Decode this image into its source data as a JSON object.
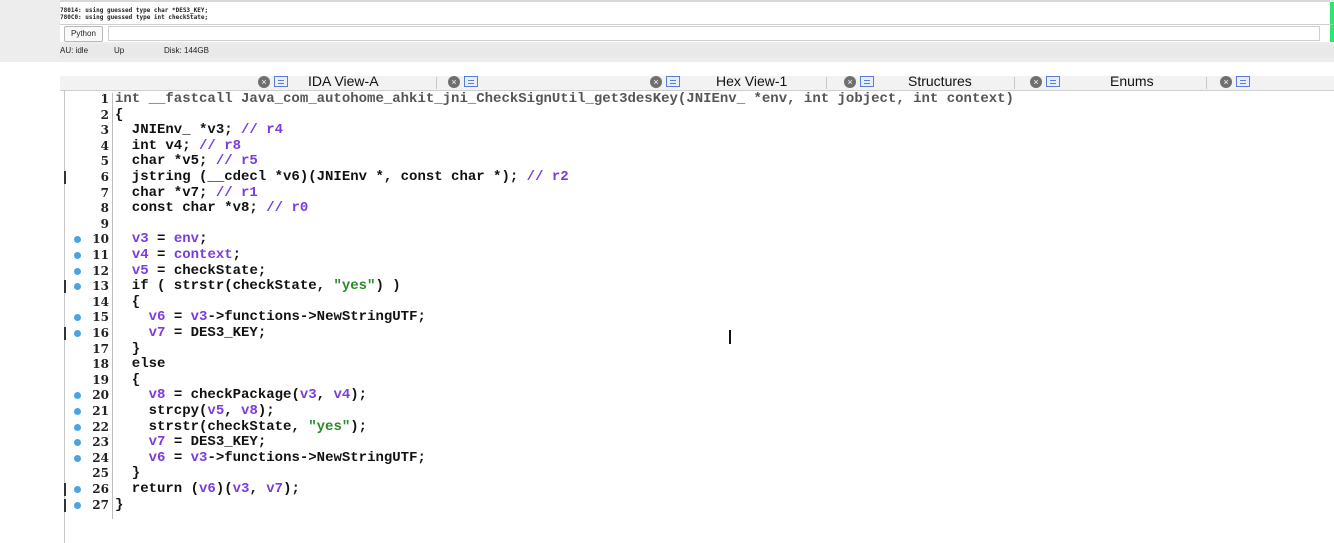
{
  "output": {
    "lines": [
      "78014: using guessed type char *DES3_KEY;",
      "780C0: using guessed type int checkState;"
    ],
    "interpreter_button": "Python"
  },
  "status": {
    "state": "AU: idle",
    "direction": "Up",
    "disk": "Disk: 144GB"
  },
  "tabs": [
    {
      "label": "IDA View-A"
    },
    {
      "label": ""
    },
    {
      "label": "Hex View-1"
    },
    {
      "label": "Structures"
    },
    {
      "label": "Enums"
    }
  ],
  "editor": {
    "lines": [
      {
        "no": "1",
        "bp": false,
        "mark": false,
        "code": [
          [
            "int __fastcall Java_com_autohome_ahkit_jni_CheckSignUtil_get3desKey(JNIEnv_ *env, int jobject, int context)",
            "decl"
          ]
        ]
      },
      {
        "no": "2",
        "bp": false,
        "mark": false,
        "code": [
          [
            "{",
            ""
          ]
        ]
      },
      {
        "no": "3",
        "bp": false,
        "mark": false,
        "code": [
          [
            "  JNIEnv_ *v3; ",
            ""
          ],
          [
            "// r4",
            "var"
          ]
        ]
      },
      {
        "no": "4",
        "bp": false,
        "mark": false,
        "code": [
          [
            "  int v4; ",
            ""
          ],
          [
            "// r8",
            "var"
          ]
        ]
      },
      {
        "no": "5",
        "bp": false,
        "mark": false,
        "code": [
          [
            "  char *v5; ",
            ""
          ],
          [
            "// r5",
            "var"
          ]
        ]
      },
      {
        "no": "6",
        "bp": false,
        "mark": true,
        "code": [
          [
            "  jstring (__cdecl *v6)(JNIEnv *, const char *); ",
            ""
          ],
          [
            "// r2",
            "var"
          ]
        ]
      },
      {
        "no": "7",
        "bp": false,
        "mark": false,
        "code": [
          [
            "  char *v7; ",
            ""
          ],
          [
            "// r1",
            "var"
          ]
        ]
      },
      {
        "no": "8",
        "bp": false,
        "mark": false,
        "code": [
          [
            "  const char *v8; ",
            ""
          ],
          [
            "// r0",
            "var"
          ]
        ]
      },
      {
        "no": "9",
        "bp": false,
        "mark": false,
        "code": [
          [
            "",
            ""
          ]
        ]
      },
      {
        "no": "10",
        "bp": true,
        "mark": false,
        "code": [
          [
            "  ",
            ""
          ],
          [
            "v3",
            "var"
          ],
          [
            " = ",
            ""
          ],
          [
            "env",
            "var"
          ],
          [
            ";",
            ""
          ]
        ]
      },
      {
        "no": "11",
        "bp": true,
        "mark": false,
        "code": [
          [
            "  ",
            ""
          ],
          [
            "v4",
            "var"
          ],
          [
            " = ",
            ""
          ],
          [
            "context",
            "var"
          ],
          [
            ";",
            ""
          ]
        ]
      },
      {
        "no": "12",
        "bp": true,
        "mark": false,
        "code": [
          [
            "  ",
            ""
          ],
          [
            "v5",
            "var"
          ],
          [
            " = checkState;",
            ""
          ]
        ]
      },
      {
        "no": "13",
        "bp": true,
        "mark": true,
        "code": [
          [
            "  if ( strstr(checkState, ",
            ""
          ],
          [
            "\"yes\"",
            "str"
          ],
          [
            ") )",
            ""
          ]
        ]
      },
      {
        "no": "14",
        "bp": false,
        "mark": false,
        "code": [
          [
            "  {",
            ""
          ]
        ]
      },
      {
        "no": "15",
        "bp": true,
        "mark": false,
        "code": [
          [
            "    ",
            ""
          ],
          [
            "v6",
            "var"
          ],
          [
            " = ",
            ""
          ],
          [
            "v3",
            "var"
          ],
          [
            "->functions->NewStringUTF;",
            ""
          ]
        ]
      },
      {
        "no": "16",
        "bp": true,
        "mark": true,
        "code": [
          [
            "    ",
            ""
          ],
          [
            "v7",
            "var"
          ],
          [
            " = DES3_KEY;",
            ""
          ]
        ]
      },
      {
        "no": "17",
        "bp": false,
        "mark": false,
        "code": [
          [
            "  }",
            ""
          ]
        ]
      },
      {
        "no": "18",
        "bp": false,
        "mark": false,
        "code": [
          [
            "  else",
            ""
          ]
        ]
      },
      {
        "no": "19",
        "bp": false,
        "mark": false,
        "code": [
          [
            "  {",
            ""
          ]
        ]
      },
      {
        "no": "20",
        "bp": true,
        "mark": false,
        "code": [
          [
            "    ",
            ""
          ],
          [
            "v8",
            "var"
          ],
          [
            " = checkPackage(",
            ""
          ],
          [
            "v3",
            "var"
          ],
          [
            ", ",
            ""
          ],
          [
            "v4",
            "var"
          ],
          [
            ");",
            ""
          ]
        ]
      },
      {
        "no": "21",
        "bp": true,
        "mark": false,
        "code": [
          [
            "    strcpy(",
            ""
          ],
          [
            "v5",
            "var"
          ],
          [
            ", ",
            ""
          ],
          [
            "v8",
            "var"
          ],
          [
            ");",
            ""
          ]
        ]
      },
      {
        "no": "22",
        "bp": true,
        "mark": false,
        "code": [
          [
            "    strstr(checkState, ",
            ""
          ],
          [
            "\"yes\"",
            "str"
          ],
          [
            ");",
            ""
          ]
        ]
      },
      {
        "no": "23",
        "bp": true,
        "mark": false,
        "code": [
          [
            "    ",
            ""
          ],
          [
            "v7",
            "var"
          ],
          [
            " = DES3_KEY;",
            ""
          ]
        ]
      },
      {
        "no": "24",
        "bp": true,
        "mark": false,
        "code": [
          [
            "    ",
            ""
          ],
          [
            "v6",
            "var"
          ],
          [
            " = ",
            ""
          ],
          [
            "v3",
            "var"
          ],
          [
            "->functions->NewStringUTF;",
            ""
          ]
        ]
      },
      {
        "no": "25",
        "bp": false,
        "mark": false,
        "code": [
          [
            "  }",
            ""
          ]
        ]
      },
      {
        "no": "26",
        "bp": true,
        "mark": true,
        "code": [
          [
            "  return (",
            ""
          ],
          [
            "v6",
            "var"
          ],
          [
            ")(",
            ""
          ],
          [
            "v3",
            "var"
          ],
          [
            ", ",
            ""
          ],
          [
            "v7",
            "var"
          ],
          [
            ");",
            ""
          ]
        ]
      },
      {
        "no": "27",
        "bp": true,
        "mark": true,
        "code": [
          [
            "}",
            ""
          ]
        ]
      }
    ]
  }
}
